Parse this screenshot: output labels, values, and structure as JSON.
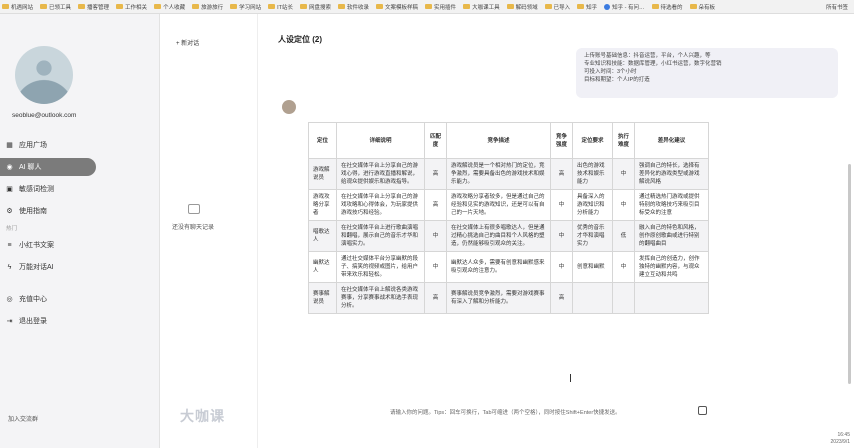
{
  "bookmarks": [
    {
      "label": "机遇网站",
      "icon": "folder-icon"
    },
    {
      "label": "已领工具",
      "icon": "folder-icon"
    },
    {
      "label": "播客管理",
      "icon": "folder-icon"
    },
    {
      "label": "工作相关",
      "icon": "folder-icon"
    },
    {
      "label": "个人收藏",
      "icon": "folder-icon"
    },
    {
      "label": "旅游旅行",
      "icon": "folder-icon"
    },
    {
      "label": "学习网站",
      "icon": "folder-icon"
    },
    {
      "label": "IT站长",
      "icon": "folder-icon"
    },
    {
      "label": "网盘搜索",
      "icon": "folder-icon"
    },
    {
      "label": "软件收录",
      "icon": "folder-icon"
    },
    {
      "label": "文案模板样稿",
      "icon": "folder-icon"
    },
    {
      "label": "实用插件",
      "icon": "folder-icon"
    },
    {
      "label": "大咖课工具",
      "icon": "folder-icon"
    },
    {
      "label": "解码领域",
      "icon": "folder-icon"
    },
    {
      "label": "已导入",
      "icon": "folder-icon"
    },
    {
      "label": "知乎",
      "icon": "folder-icon"
    },
    {
      "label": "知乎 - 有问…",
      "icon": "site-icon"
    },
    {
      "label": "待选看的",
      "icon": "folder-icon"
    },
    {
      "label": "朵有板",
      "icon": "folder-icon"
    }
  ],
  "bookmarks_right": "所有书签",
  "sidebar": {
    "email": "seoblue@outlook.com",
    "items": [
      {
        "label": "应用广场",
        "icon": "grid-icon",
        "active": false
      },
      {
        "label": "AI 聊人",
        "icon": "chat-icon",
        "active": true
      },
      {
        "label": "敏感词检测",
        "icon": "shield-icon",
        "active": false
      },
      {
        "label": "使用指南",
        "icon": "gear-icon",
        "active": false
      }
    ],
    "section_label": "热门",
    "hot_items": [
      {
        "label": "小红书文案",
        "icon": "note-icon"
      },
      {
        "label": "万能对话AI",
        "icon": "bolt-icon"
      }
    ],
    "account_items": [
      {
        "label": "充值中心",
        "icon": "wallet-icon"
      },
      {
        "label": "退出登录",
        "icon": "logout-icon"
      }
    ],
    "bottom": "加入交流群"
  },
  "history": {
    "new_chat": "+ 新对话",
    "empty": "还没有聊天记录",
    "watermark": "大咖课"
  },
  "main": {
    "title": "人设定位 (2)",
    "note_lines": [
      "上传账号基础信息：抖音运营，平台，个人兴趣，等",
      "专业知识和技能：数据库管理，小红书运营，数字化营销",
      "可投入时间：3个小时",
      "目标和期望：个人IP的打造"
    ],
    "table": {
      "headers": [
        "定位",
        "详细说明",
        "匹配度",
        "竞争描述",
        "竞争强度",
        "定位要求",
        "执行难度",
        "差异化建议"
      ],
      "rows": [
        [
          "游戏解说员",
          "在社交媒体平台上分享自己的游戏心得，进行游戏直播和解说，给观众提供娱乐和游戏指导。",
          "高",
          "游戏解说员是一个相对热门的定位，竞争激烈，需要具备出色的游戏技术和娱乐能力。",
          "高",
          "出色的游戏技术和娱乐能力",
          "中",
          "强调自己的特长，选择有差异化的游戏类型或游戏解说风格"
        ],
        [
          "游戏攻略分享者",
          "在社交媒体平台上分享自己的游戏攻略和心得体会，为玩家提供游戏技巧和经验。",
          "高",
          "游戏攻略分享者较多，但是通过自己的经验和见实的游戏知识，还是可以有自己的一片天地。",
          "中",
          "具备深入的游戏知识和分析能力",
          "中",
          "通过精选热门游戏或提供特别的攻略技巧来吸引目标受众的注意"
        ],
        [
          "唱歌达人",
          "在社交媒体平台上进行歌曲演唱和翻唱，展示自己的音乐才华和演唱实力。",
          "中",
          "在社交媒体上有很多唱歌达人，但是通过精心挑选自己的曲目和个人风格的塑造，仍然能够吸引观众的关注。",
          "中",
          "优秀的音乐才华和演唱实力",
          "低",
          "融入自己的特色和风格，创作原创歌曲或进行特别的翻唱曲目"
        ],
        [
          "幽默达人",
          "通过社交媒体平台分享幽默的段子、搞笑的视频或图片，给用户带来欢乐和轻松。",
          "中",
          "幽默达人众多，需要有创意和幽默感来吸引观众的注意力。",
          "中",
          "创意和幽默",
          "中",
          "发挥自己的创造力，创作独特的幽默内容，与观众建立互动和共鸣"
        ],
        [
          "赛事解说员",
          "在社交媒体平台上解说各类游戏赛事，分享赛事战术和选手表现分析。",
          "高",
          "赛事解说员竞争激烈，需要对游戏赛事有深入了解和分析能力。",
          "高",
          "",
          "",
          ""
        ]
      ]
    },
    "input_hint": "请输入你的问题。Tips：回车可换行，Tab可缩进（两个空格），同时按住Shift+Enter快捷发送。"
  },
  "corner": {
    "line1": "16:45",
    "line2": "2023/9/1"
  }
}
